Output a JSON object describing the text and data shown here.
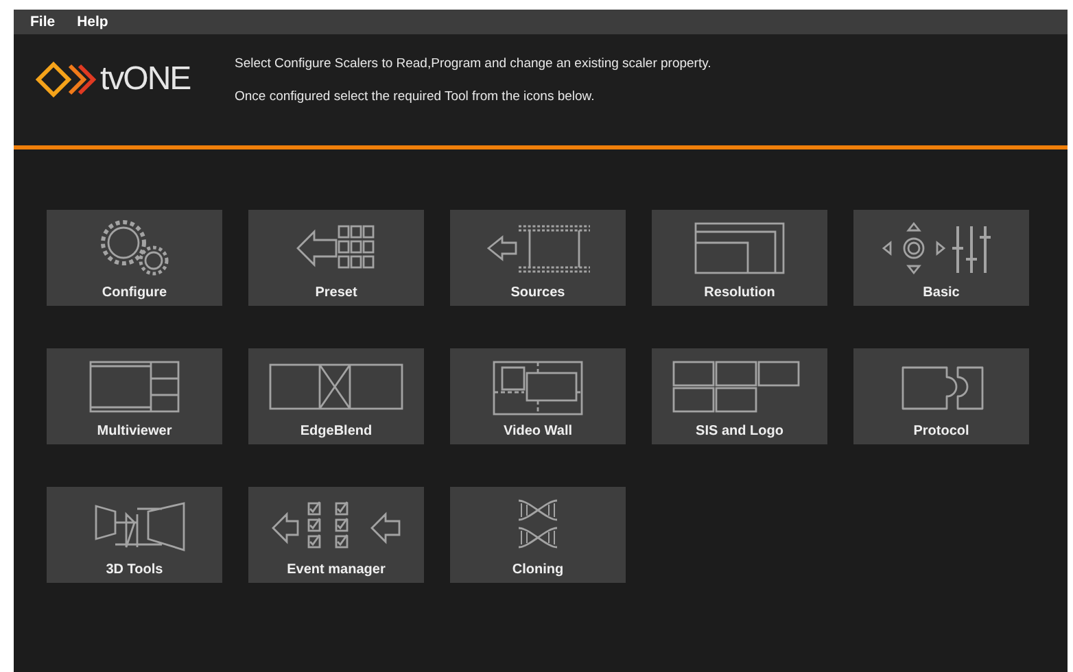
{
  "menu": [
    {
      "label": "File"
    },
    {
      "label": "Help"
    }
  ],
  "header": {
    "logo_text": "tvONE",
    "lines": [
      "Select Configure Scalers to Read,Program and change an existing scaler property.",
      "Once configured select the required Tool from the icons below."
    ]
  },
  "tools": [
    {
      "label": "Configure",
      "kind": "configure"
    },
    {
      "label": "Preset",
      "kind": "preset"
    },
    {
      "label": "Sources",
      "kind": "sources"
    },
    {
      "label": "Resolution",
      "kind": "resolution"
    },
    {
      "label": "Basic",
      "kind": "basic"
    },
    {
      "label": "Multiviewer",
      "kind": "multiviewer"
    },
    {
      "label": "EdgeBlend",
      "kind": "edgeblend"
    },
    {
      "label": "Video Wall",
      "kind": "videowall"
    },
    {
      "label": "SIS and Logo",
      "kind": "sis"
    },
    {
      "label": "Protocol",
      "kind": "protocol"
    },
    {
      "label": "3D Tools",
      "kind": "threed"
    },
    {
      "label": "Event manager",
      "kind": "events"
    },
    {
      "label": "Cloning",
      "kind": "cloning"
    }
  ]
}
